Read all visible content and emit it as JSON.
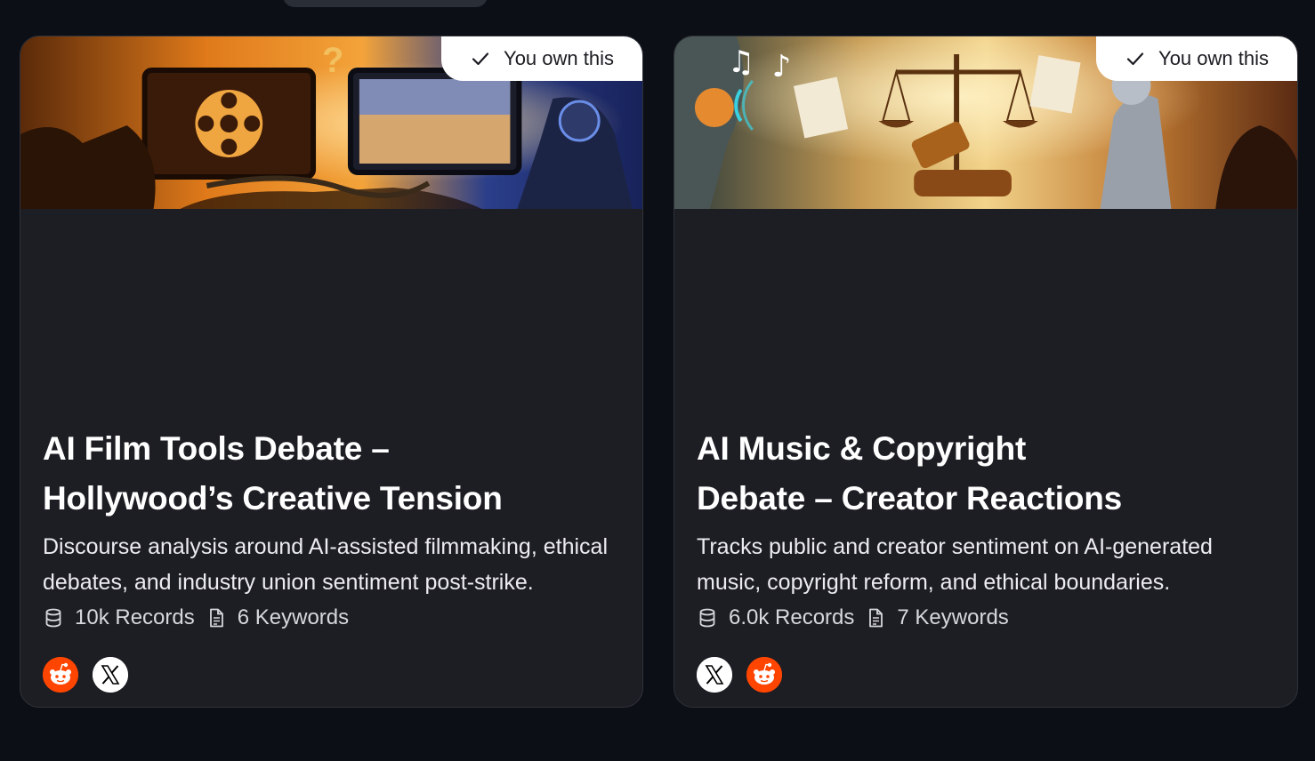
{
  "cards": [
    {
      "owned_label": "You own this",
      "title_line1": "AI Film Tools Debate –",
      "title_line2": "Hollywood’s Creative Tension",
      "description": "Discourse analysis around AI-assisted filmmaking, ethical debates, and industry union sentiment post-strike.",
      "records": "10k Records",
      "keywords": "6 Keywords",
      "sources": [
        "reddit-icon",
        "x-icon"
      ],
      "banner_icon": "film-vs-robot-illustration"
    },
    {
      "owned_label": "You own this",
      "title_line1": "AI Music & Copyright",
      "title_line2": "Debate – Creator Reactions",
      "description": "Tracks public and creator sentiment on AI-generated music, copyright reform, and ethical boundaries.",
      "records": "6.0k Records",
      "keywords": "7 Keywords",
      "sources": [
        "x-icon",
        "reddit-icon"
      ],
      "banner_icon": "music-copyright-illustration"
    }
  ],
  "colors": {
    "page_bg": "#0c0f15",
    "card_bg": "#1d1e24",
    "reddit": "#ff4500",
    "badge_bg": "#ffffff"
  }
}
